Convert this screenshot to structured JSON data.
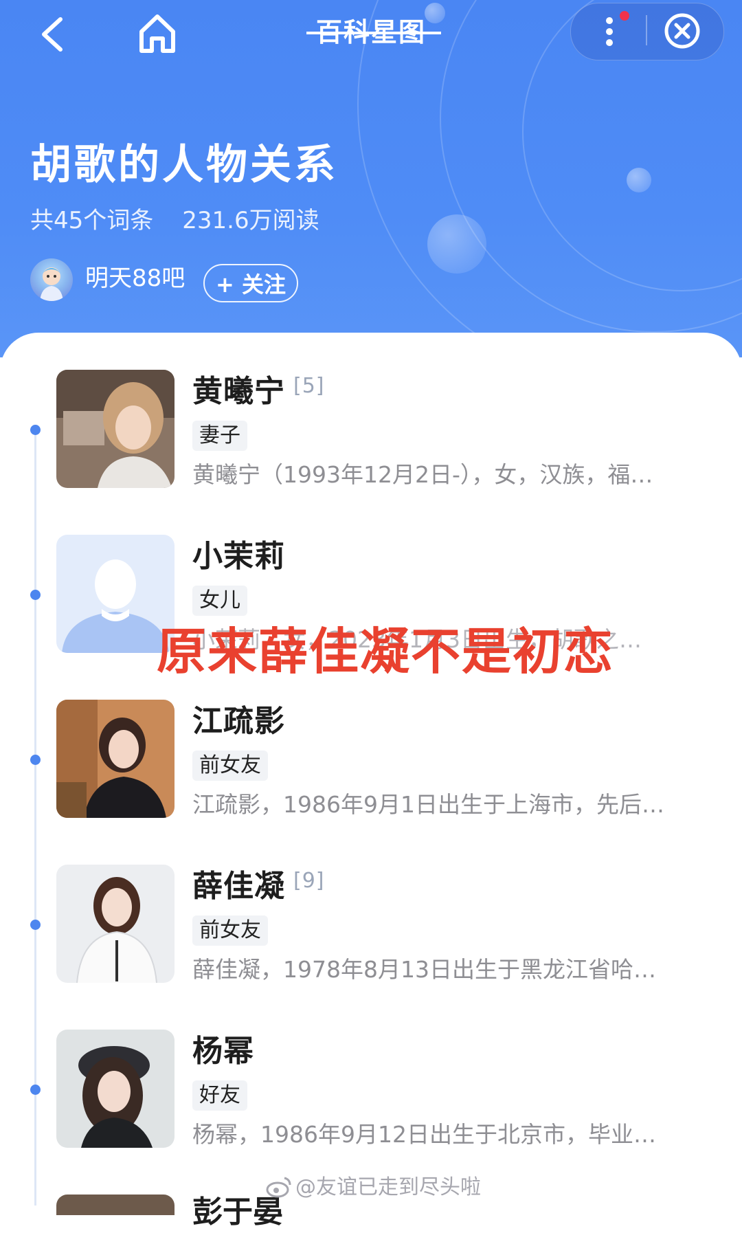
{
  "topbar": {
    "title": "百科星图"
  },
  "header": {
    "title": "胡歌的人物关系",
    "entry_count": "共45个词条",
    "read_count": "231.6万阅读",
    "author": "明天88吧",
    "follow_label": "+ 关注"
  },
  "items": [
    {
      "name": "黄曦宁",
      "ref": "[5]",
      "tag": "妻子",
      "desc": "黄曦宁（1993年12月2日-），女，汉族，福…"
    },
    {
      "name": "小茉莉",
      "ref": "",
      "tag": "女儿",
      "desc": "小茉莉，女，2023年1月3日出生，胡歌之…"
    },
    {
      "name": "江疏影",
      "ref": "",
      "tag": "前女友",
      "desc": "江疏影，1986年9月1日出生于上海市，先后…"
    },
    {
      "name": "薛佳凝",
      "ref": "[9]",
      "tag": "前女友",
      "desc": "薛佳凝，1978年8月13日出生于黑龙江省哈…"
    },
    {
      "name": "杨幂",
      "ref": "",
      "tag": "好友",
      "desc": "杨幂，1986年9月12日出生于北京市，毕业…"
    }
  ],
  "next_item": {
    "name": "彭于晏"
  },
  "overlay_text": "原来薛佳凝不是初恋",
  "watermark": "@友谊已走到尽头啦",
  "colors": {
    "header_blue": "#4f8cf6",
    "accent_dot": "#4d86ef",
    "overlay_red": "#e9412f"
  }
}
